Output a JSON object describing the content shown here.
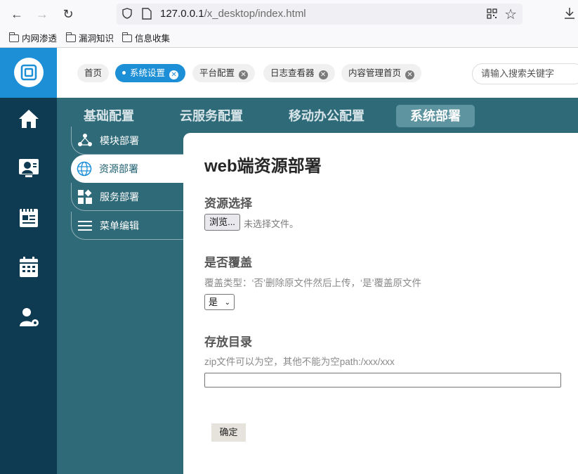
{
  "browser": {
    "url_host": "127.0.0.1",
    "url_path": "/x_desktop/index.html",
    "bookmarks": [
      "内网渗透",
      "漏洞知识",
      "信息收集"
    ]
  },
  "tags": [
    {
      "label": "首页",
      "closable": false
    },
    {
      "label": "系统设置",
      "closable": true,
      "active": true
    },
    {
      "label": "平台配置",
      "closable": true
    },
    {
      "label": "日志查看器",
      "closable": true
    },
    {
      "label": "内容管理首页",
      "closable": true
    }
  ],
  "search": {
    "placeholder": "请输入搜索关键字"
  },
  "top_tabs": [
    "基础配置",
    "云服务配置",
    "移动办公配置",
    "系统部署"
  ],
  "subnav": [
    "模块部署",
    "资源部署",
    "服务部署",
    "菜单编辑"
  ],
  "page": {
    "title": "web端资源部署",
    "resource_label": "资源选择",
    "file_button": "浏览...",
    "file_status": "未选择文件。",
    "overwrite_label": "是否覆盖",
    "overwrite_hint": "覆盖类型：‘否’删除原文件然后上传，‘是’覆盖原文件",
    "overwrite_value": "是",
    "dir_label": "存放目录",
    "dir_hint": "zip文件可以为空，其他不能为空path:/xxx/xxx",
    "dir_value": "",
    "submit": "确定"
  },
  "colors": {
    "sidebar": "#0e3a52",
    "accent": "#1c8fd6",
    "main": "#2f6a78",
    "active_tab": "#5e93a0"
  }
}
